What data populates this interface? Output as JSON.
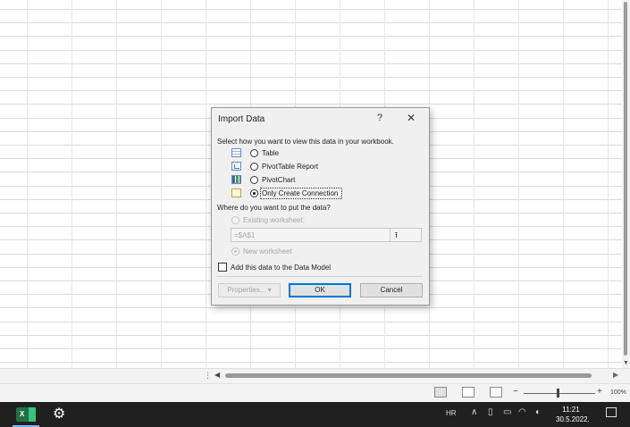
{
  "dialog": {
    "title": "Import Data",
    "help": "?",
    "close": "✕",
    "view_prompt": "Select how you want to view this data in your workbook.",
    "view_options": [
      "Table",
      "PivotTable Report",
      "PivotChart",
      "Only Create Connection"
    ],
    "selected_view": "Only Create Connection",
    "put_prompt": "Where do you want to put the data?",
    "existing_worksheet": "Existing worksheet:",
    "cell_reference": "=$A$1",
    "collapse_glyph": "⭱",
    "new_worksheet": "New worksheet",
    "data_model": "Add this data to the Data Model",
    "data_model_checked": false,
    "buttons": {
      "properties": "Properties...",
      "properties_arrow": "▾",
      "ok": "OK",
      "cancel": "Cancel"
    }
  },
  "scroll": {
    "left_arrow": "◀",
    "right_arrow": "▶",
    "down_arrow": "▼",
    "dots": "⋮"
  },
  "status_bar": {
    "zoom_minus": "−",
    "zoom_plus": "+",
    "zoom_level": "100%"
  },
  "taskbar": {
    "excel_letter": "X",
    "gear": "⚙",
    "language": "HR",
    "tray_chevron": "∧",
    "time": "11:21",
    "date": "30.5.2022."
  },
  "colors": {
    "excel_green": "#1e7145",
    "taskbar": "#202020",
    "dialog_bg": "#f0f0f0",
    "accent": "#0078d7"
  }
}
